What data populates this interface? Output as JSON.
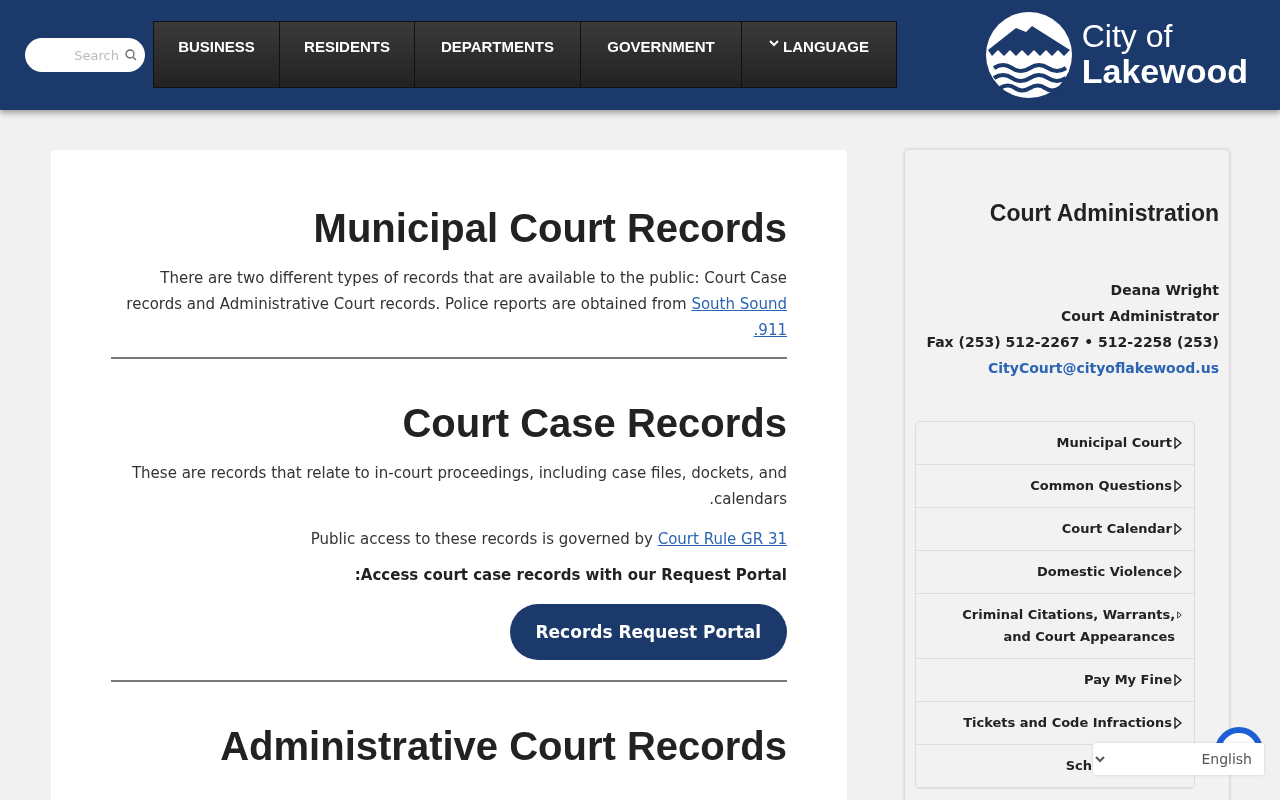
{
  "header": {
    "search": {
      "placeholder": "Search"
    },
    "nav": [
      {
        "label": "BUSINESS",
        "dropdown": false
      },
      {
        "label": "RESIDENTS",
        "dropdown": false
      },
      {
        "label": "DEPARTMENTS",
        "dropdown": false
      },
      {
        "label": "GOVERNMENT",
        "dropdown": false
      },
      {
        "label": "LANGUAGE",
        "dropdown": true
      }
    ],
    "logo": {
      "line1": "City of",
      "line2": "Lakewood"
    }
  },
  "main": {
    "sections": [
      {
        "title": "Municipal Court Records",
        "blocks": [
          {
            "kind": "paragraph",
            "text": "There are two different types of records that are available to the public: Court Case records and Administrative Court records. Police reports are obtained from",
            "link": "South Sound",
            "link_continued": ".911"
          }
        ],
        "divider": true
      },
      {
        "title": "Court Case Records",
        "blocks": [
          {
            "kind": "paragraph",
            "text": "These are records that relate to in-court proceedings, including case files, dockets, and .calendars"
          },
          {
            "kind": "paragraph",
            "text": "Public access to these records is governed by",
            "link": "Court Rule GR 31"
          },
          {
            "kind": "strong",
            "text": ":Access court case records with our Request Portal"
          },
          {
            "kind": "button",
            "text": "Records Request Portal"
          }
        ],
        "divider": true
      },
      {
        "title": "Administrative Court Records",
        "divider": false
      }
    ]
  },
  "sidebar": {
    "title": "Court Administration",
    "contact": [
      {
        "kind": "text",
        "text": "Deana Wright"
      },
      {
        "kind": "text",
        "text": "Court Administrator"
      },
      {
        "kind": "text",
        "text": "Fax (253) 512-2267 • 512-2258 (253)"
      },
      {
        "kind": "link",
        "text": "CityCourt@cityoflakewood.us"
      }
    ],
    "menu": [
      {
        "label": "Municipal Court",
        "arrow": true
      },
      {
        "label": "Common Questions",
        "arrow": true
      },
      {
        "label": "Court Calendar",
        "arrow": true
      },
      {
        "label": "Domestic Violence",
        "arrow": true
      },
      {
        "label": "Criminal Citations, Warrants, and Court Appearances",
        "arrow": true
      },
      {
        "label": "Pay My Fine",
        "arrow": true
      },
      {
        "label": "Tickets and Code Infractions",
        "arrow": true
      },
      {
        "label": "Sch",
        "arrow": false
      }
    ]
  },
  "language_select": {
    "value": "English"
  }
}
